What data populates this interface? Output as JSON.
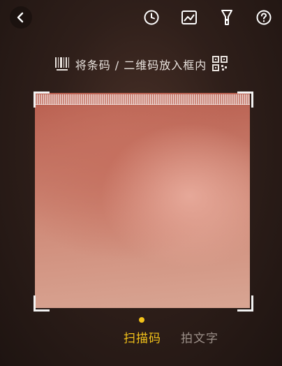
{
  "topbar": {
    "icons": [
      "chevron-left-icon",
      "history-clock-icon",
      "image-gallery-icon",
      "flashlight-icon",
      "help-icon"
    ]
  },
  "hint": {
    "text": "将条码 / 二维码放入框内",
    "left_icon": "barcode-icon",
    "right_icon": "qrcode-icon"
  },
  "modes": {
    "scan_label": "扫描码",
    "photo_label": "拍文字",
    "active": "scan",
    "active_color": "#f3c21a"
  }
}
